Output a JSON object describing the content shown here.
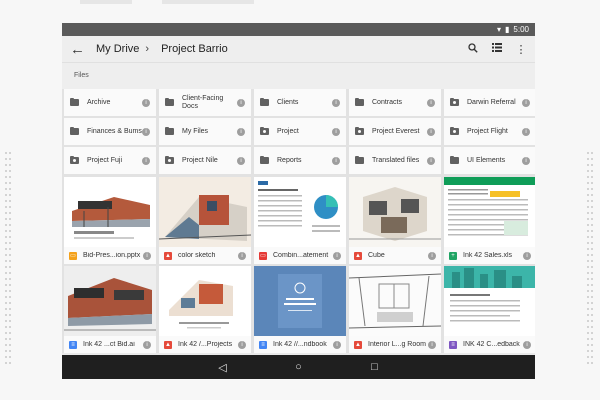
{
  "status": {
    "time": "5:00"
  },
  "appbar": {
    "breadcrumb": [
      "My Drive",
      "Project Barrio"
    ]
  },
  "section_label": "Files",
  "folders": [
    {
      "name": "Archive",
      "shared": false
    },
    {
      "name": "Client-Facing Docs",
      "shared": false
    },
    {
      "name": "Clients",
      "shared": false
    },
    {
      "name": "Contracts",
      "shared": false
    },
    {
      "name": "Darwin Referral",
      "shared": true
    },
    {
      "name": "Finances & Bums",
      "shared": false
    },
    {
      "name": "My Files",
      "shared": false
    },
    {
      "name": "Project",
      "shared": true
    },
    {
      "name": "Project Everest",
      "shared": true
    },
    {
      "name": "Project Flight",
      "shared": true
    },
    {
      "name": "Project Fuji",
      "shared": true
    },
    {
      "name": "Project Nile",
      "shared": true
    },
    {
      "name": "Reports",
      "shared": false
    },
    {
      "name": "Translated files",
      "shared": false
    },
    {
      "name": "UI Elements",
      "shared": false
    }
  ],
  "files": [
    {
      "name": "Bid-Pres...ion.pptx",
      "type": "slides",
      "color": "#f4a11a",
      "thumb": "arch1"
    },
    {
      "name": "color sketch",
      "type": "image",
      "color": "#e5493a",
      "thumb": "sketch1"
    },
    {
      "name": "Combin...atement",
      "type": "pdf",
      "color": "#e53935",
      "thumb": "doc1"
    },
    {
      "name": "Cube",
      "type": "image",
      "color": "#e5493a",
      "thumb": "cube"
    },
    {
      "name": "Ink 42 Sales.xls",
      "type": "sheet",
      "color": "#1fa463",
      "thumb": "sheet1"
    },
    {
      "name": "Ink 42 ...ct Bid.ai",
      "type": "doc",
      "color": "#4285f4",
      "thumb": "arch2"
    },
    {
      "name": "Ink 42 /...Projects",
      "type": "image",
      "color": "#e5493a",
      "thumb": "sketch2"
    },
    {
      "name": "Ink 42 //...ndbook",
      "type": "doc",
      "color": "#4285f4",
      "thumb": "handbook"
    },
    {
      "name": "Interior L...g Room",
      "type": "image",
      "color": "#e5493a",
      "thumb": "interior"
    },
    {
      "name": "INK 42 C...edback",
      "type": "forms",
      "color": "#7e57c2",
      "thumb": "city"
    }
  ],
  "nav": {
    "back": "back-icon",
    "home": "home-icon",
    "recents": "recents-icon"
  }
}
